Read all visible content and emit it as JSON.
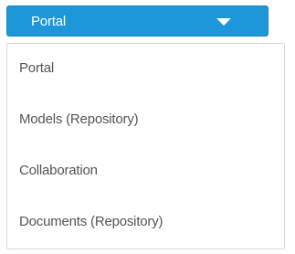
{
  "dropdown": {
    "selected_label": "Portal",
    "caret_icon": "caret-down-icon",
    "button_color": "#1d97da"
  },
  "menu": {
    "items": [
      {
        "label": "Portal"
      },
      {
        "label": "Models (Repository)"
      },
      {
        "label": "Collaboration"
      },
      {
        "label": "Documents (Repository)"
      }
    ]
  }
}
